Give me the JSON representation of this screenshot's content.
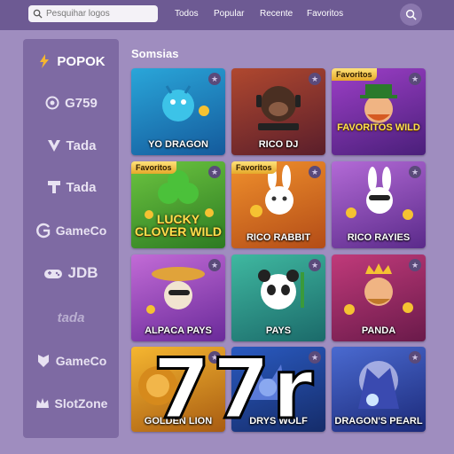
{
  "search": {
    "placeholder": "Pesquihar logos"
  },
  "nav": {
    "items": [
      "Todos",
      "Popular",
      "Recente",
      "Favoritos"
    ]
  },
  "sidebar": {
    "providers": [
      {
        "label": "POPOK",
        "icon": "lightning-icon"
      },
      {
        "label": "G759",
        "icon": "ring-icon"
      },
      {
        "label": "Tada",
        "icon": "v-shield-icon"
      },
      {
        "label": "Tada",
        "icon": "t-shield-icon"
      },
      {
        "label": "GameCo",
        "icon": "g-arrow-icon"
      },
      {
        "label": "JDB",
        "icon": "gamepad-icon"
      },
      {
        "label": "tada",
        "icon": "script-logo-icon"
      },
      {
        "label": "GameCo",
        "icon": "crest-icon"
      },
      {
        "label": "SlotZone",
        "icon": "crown-icon"
      }
    ]
  },
  "section": {
    "title": "Somsias"
  },
  "favorite_badge": "Favoritos",
  "games": [
    {
      "name": "YO DRAGON",
      "bg": [
        "#2aa6d9",
        "#145a9c"
      ],
      "motif": "dragon"
    },
    {
      "name": "RICO DJ",
      "bg": [
        "#b0482f",
        "#5a1e2b"
      ],
      "motif": "gorilla"
    },
    {
      "name": "",
      "bg": [
        "#9d3fc7",
        "#4a1f7a"
      ],
      "motif": "leprechaun",
      "favorite": true,
      "art_text": "FAVORITOS WILD"
    },
    {
      "name": "",
      "bg": [
        "#6cc540",
        "#2d7a22"
      ],
      "motif": "clover",
      "favorite": true,
      "art_text": "LUCKY CLOVER WILD"
    },
    {
      "name": "RICO RABBIT",
      "bg": [
        "#f0902c",
        "#b34c17"
      ],
      "motif": "rabbit",
      "favorite": true
    },
    {
      "name": "RICO RAYIES",
      "bg": [
        "#b36ad6",
        "#5a2a8a"
      ],
      "motif": "bunny"
    },
    {
      "name": "ALPACA PAYS",
      "bg": [
        "#c26bd6",
        "#6a2a9a"
      ],
      "motif": "alpaca"
    },
    {
      "name": "PAYS",
      "bg": [
        "#3fb8a0",
        "#1b6a6a"
      ],
      "motif": "panda"
    },
    {
      "name": "PANDA",
      "bg": [
        "#c03a7a",
        "#6a1a4a"
      ],
      "motif": "king"
    },
    {
      "name": "GOLDEN LION",
      "bg": [
        "#f5b630",
        "#a85c12"
      ],
      "motif": "lion"
    },
    {
      "name": "DRYS WOLF",
      "bg": [
        "#2a5ac0",
        "#152c6a"
      ],
      "motif": "wolf"
    },
    {
      "name": "DRAGON'S PEARL",
      "bg": [
        "#4a6ad0",
        "#1c2a7a"
      ],
      "motif": "dragon-pearl"
    }
  ],
  "overlay_text": "77r",
  "colors": {
    "topbar": "#6d5a93",
    "sidebar": "#7e6aa3",
    "page": "#9f8dbf",
    "gold": "#ffe04d"
  }
}
